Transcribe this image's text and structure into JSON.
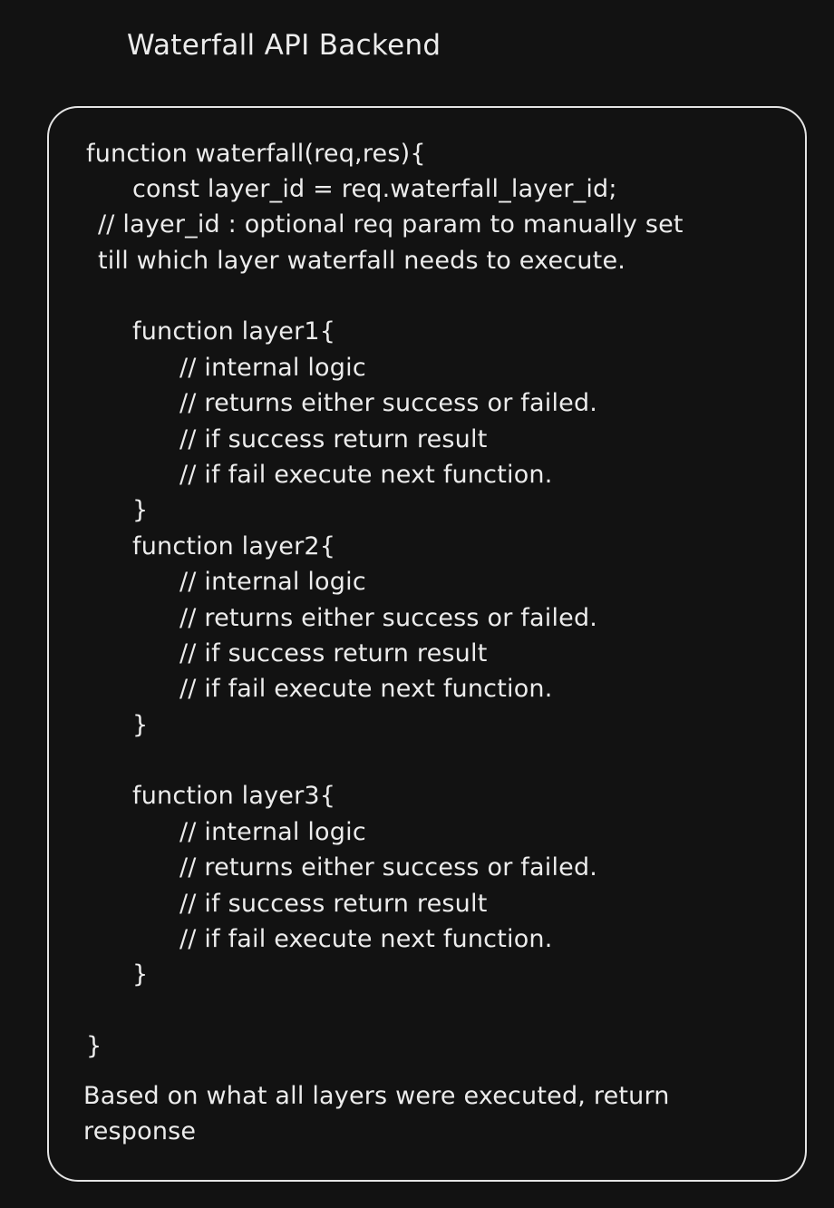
{
  "title": "Waterfall API Backend",
  "code_lines": [
    "function waterfall(req,res){",
    "const layer_id = req.waterfall_layer_id;",
    "// layer_id : optional req param to manually set",
    "till which layer waterfall needs to execute.",
    "function layer1{",
    "// internal logic",
    "// returns either success or failed.",
    "// if success return result",
    "// if fail execute next function.",
    "}",
    "function layer2{",
    "// internal logic",
    "// returns either success or failed.",
    "// if success return result",
    "// if fail execute next function.",
    "}",
    "function layer3{",
    "// internal logic",
    "// returns either success or failed.",
    "// if success return result",
    "// if fail execute next function.",
    "}",
    "}"
  ],
  "footer_lines": [
    "Based on what all layers were executed, return",
    "response"
  ]
}
